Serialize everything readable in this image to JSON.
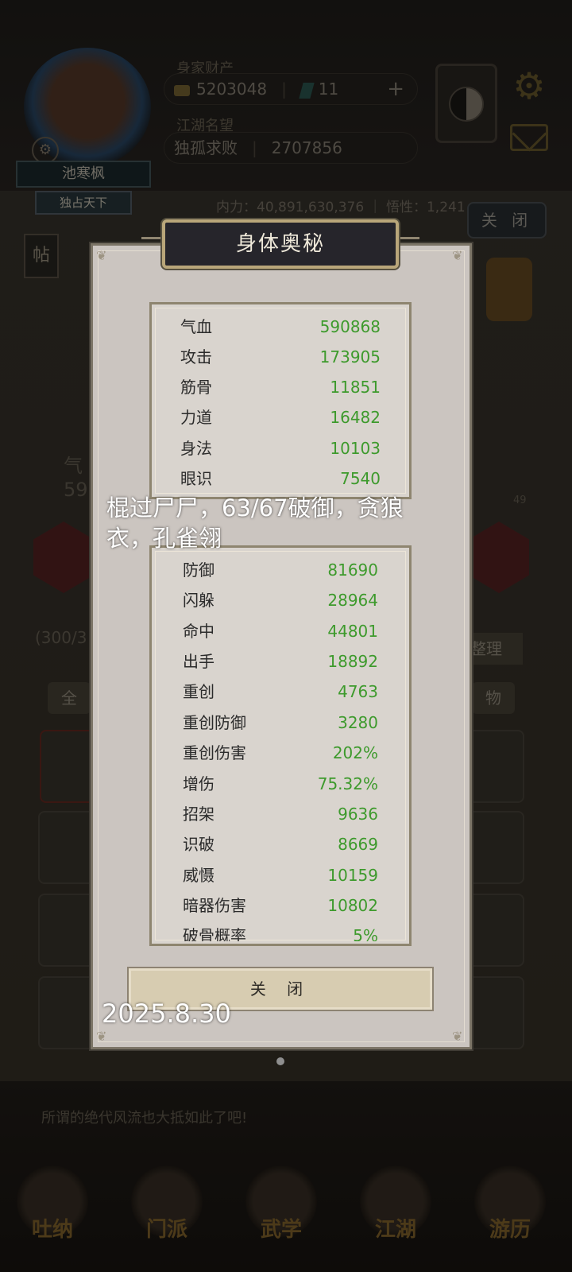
{
  "header": {
    "assets_label": "身家财产",
    "gold_value": "5203048",
    "jade_value": "11",
    "plus_label": "+",
    "reputation_label": "江湖名望",
    "reputation_title": "独孤求败",
    "reputation_value": "2707856",
    "player_name": "池寒枫",
    "player_title": "独占天下",
    "power_text": "内力：40,891,630,376 ｜ 悟性：1,241"
  },
  "background": {
    "close_label": "关 闭",
    "post_label": "帖",
    "sort_label": "整理",
    "tab_all_label": "全",
    "tab_item_label": "物",
    "capacity_text": "(300/3",
    "qi_label": "气",
    "qi_value": "59",
    "notice_line1": "所谓的绝代风流也大抵如此了吧!",
    "badge_label": "49"
  },
  "nav": [
    {
      "label": "吐纳"
    },
    {
      "label": "门派"
    },
    {
      "label": "武学"
    },
    {
      "label": "江湖"
    },
    {
      "label": "游历"
    }
  ],
  "modal": {
    "title": "身体奥秘",
    "close_label": "关 闭",
    "stats_primary": [
      {
        "name": "气血",
        "value": "590868"
      },
      {
        "name": "攻击",
        "value": "173905"
      },
      {
        "name": "筋骨",
        "value": "11851"
      },
      {
        "name": "力道",
        "value": "16482"
      },
      {
        "name": "身法",
        "value": "10103"
      },
      {
        "name": "眼识",
        "value": "7540"
      }
    ],
    "stats_secondary": [
      {
        "name": "防御",
        "value": "81690"
      },
      {
        "name": "闪躲",
        "value": "28964"
      },
      {
        "name": "命中",
        "value": "44801"
      },
      {
        "name": "出手",
        "value": "18892"
      },
      {
        "name": "重创",
        "value": "4763"
      },
      {
        "name": "重创防御",
        "value": "3280"
      },
      {
        "name": "重创伤害",
        "value": "202%"
      },
      {
        "name": "增伤",
        "value": "75.32%"
      },
      {
        "name": "招架",
        "value": "9636"
      },
      {
        "name": "识破",
        "value": "8669"
      },
      {
        "name": "威慑",
        "value": "10159"
      },
      {
        "name": "暗器伤害",
        "value": "10802"
      },
      {
        "name": "破骨概率",
        "value": "5%"
      }
    ]
  },
  "overlay": {
    "caption": "棍过尸尸，63/67破御，贪狼衣，孔雀翎",
    "date": "2025.8.30"
  }
}
